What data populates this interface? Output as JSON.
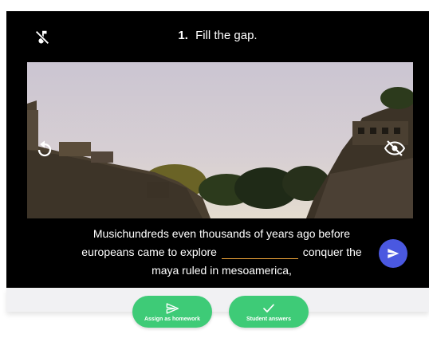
{
  "question": {
    "number": "1.",
    "instruction": "Fill the gap."
  },
  "icons": {
    "mute": "music-off-icon",
    "replay": "replay-icon",
    "hide": "eye-off-icon",
    "send": "send-icon",
    "homework": "send-icon",
    "answers": "check-icon"
  },
  "lyrics": {
    "line1": "Musichundreds even thousands of years ago before",
    "line2_before": "europeans came to explore",
    "gap_value": "",
    "line2_after": "conquer the",
    "line3": "maya ruled in mesoamerica,"
  },
  "actions": {
    "homework_label": "Assign as homework",
    "answers_label": "Student answers"
  },
  "colors": {
    "player_bg": "#000000",
    "send_button": "#4a58e0",
    "action_button": "#3ecb77",
    "gap_underline": "#f0a63a"
  }
}
